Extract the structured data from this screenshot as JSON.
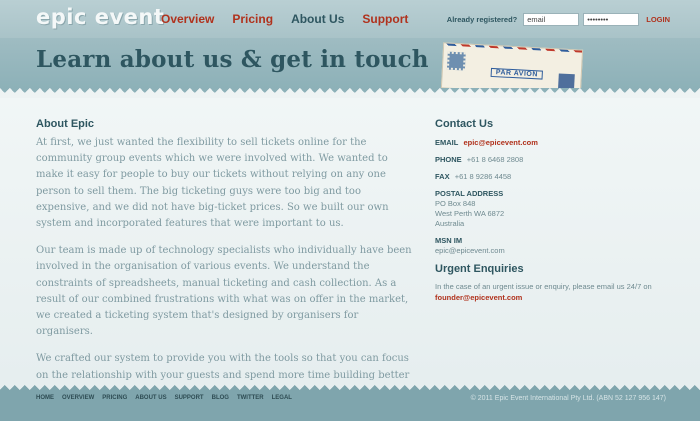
{
  "logo": "epic event",
  "nav": [
    "Overview",
    "Pricing",
    "About Us",
    "Support"
  ],
  "login": {
    "label": "Already registered?",
    "email_value": "email",
    "password_value": "••••••••",
    "button": "LOGIN"
  },
  "banner": {
    "title": "Learn about us & get in touch",
    "envelope_text": "PAR AVION"
  },
  "about": {
    "heading": "About Epic",
    "paragraphs": [
      "At first, we just wanted the flexibility to sell tickets online for the community group events which we were involved with. We wanted to make it easy for people to buy our tickets without relying on any one person to sell them. The big ticketing guys were too big and too expensive, and we did not have big-ticket prices. So we built our own system and incorporated features that were important to us.",
      "Our team is made up of technology specialists who individually have been involved in the organisation of various events. We understand the constraints of spreadsheets, manual ticketing and cash collection. As a result of our combined frustrations with what was on offer in the market, we created a ticketing system that's designed by organisers for organisers.",
      "We crafted our system to provide you with the tools so that you can focus on the relationship with your guests and spend more time building better events."
    ]
  },
  "contact": {
    "heading": "Contact Us",
    "email_label": "EMAIL",
    "email": "epic@epicevent.com",
    "phone_label": "PHONE",
    "phone": "+61 8 6468 2808",
    "fax_label": "FAX",
    "fax": "+61 8 9286 4458",
    "postal_label": "POSTAL ADDRESS",
    "postal": [
      "PO Box 848",
      "West Perth WA 6872",
      "Australia"
    ],
    "msn_label": "MSN IM",
    "msn": "epic@epicevent.com"
  },
  "urgent": {
    "heading": "Urgent Enquiries",
    "text": "In the case of an urgent issue or enquiry, please email us 24/7 on",
    "email": "founder@epicevent.com"
  },
  "footer": {
    "links": [
      "HOME",
      "OVERVIEW",
      "PRICING",
      "ABOUT US",
      "SUPPORT",
      "BLOG",
      "TWITTER",
      "LEGAL"
    ],
    "copyright": "© 2011 Epic Event International Pty Ltd. (ABN 52 127 956 147)"
  }
}
